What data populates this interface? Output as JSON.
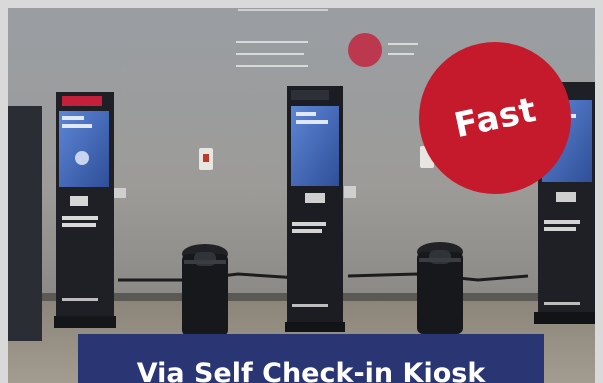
{
  "caption": {
    "text": "Via Self Check-in Kiosk",
    "background_color": "#2a3573"
  },
  "badge": {
    "text": "Fast",
    "color": "#c41a2c"
  },
  "photo": {
    "icons": [
      "kiosk-icon",
      "trash-bin-icon"
    ],
    "kiosk_screen_color": "#3f6bbf"
  }
}
